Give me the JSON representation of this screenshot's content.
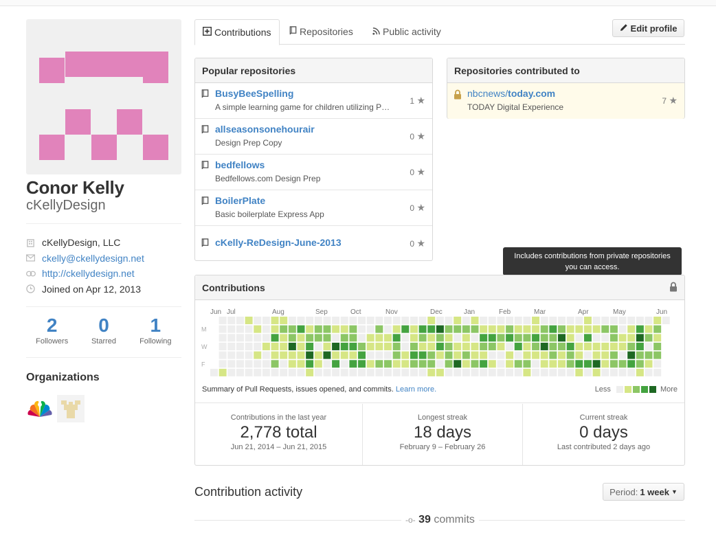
{
  "profile": {
    "full_name": "Conor Kelly",
    "username": "cKellyDesign",
    "avatar_color": "#e183bb",
    "details": [
      {
        "icon": "organization-icon",
        "text": "cKellyDesign, LLC",
        "link": false
      },
      {
        "icon": "mail-icon",
        "text": "ckelly@ckellydesign.net",
        "link": true
      },
      {
        "icon": "link-icon",
        "text": "http://ckellydesign.net",
        "link": true
      },
      {
        "icon": "clock-icon",
        "text": "Joined on Apr 12, 2013",
        "link": false
      }
    ],
    "stats": [
      {
        "value": "2",
        "label": "Followers"
      },
      {
        "value": "0",
        "label": "Starred"
      },
      {
        "value": "1",
        "label": "Following"
      }
    ],
    "organizations_title": "Organizations",
    "organizations": [
      "nbc-logo",
      "org-avatar"
    ]
  },
  "tabs": [
    {
      "label": "Contributions",
      "icon": "plus-square-icon",
      "selected": true
    },
    {
      "label": "Repositories",
      "icon": "repo-icon",
      "selected": false
    },
    {
      "label": "Public activity",
      "icon": "rss-icon",
      "selected": false
    }
  ],
  "edit_profile_label": "Edit profile",
  "popular": {
    "title": "Popular repositories",
    "repos": [
      {
        "name": "BusyBeeSpelling",
        "desc": "A simple learning game for children utilizing Pho",
        "stars": "1"
      },
      {
        "name": "allseasonsonehourair",
        "desc": "Design Prep Copy",
        "stars": "0"
      },
      {
        "name": "bedfellows",
        "desc": "Bedfellows.com Design Prep",
        "stars": "0"
      },
      {
        "name": "BoilerPlate",
        "desc": "Basic boilerplate Express App",
        "stars": "0"
      },
      {
        "name": "cKelly-ReDesign-June-2013",
        "desc": "",
        "stars": "0"
      }
    ]
  },
  "contributed": {
    "title": "Repositories contributed to",
    "repos": [
      {
        "owner": "nbcnews/",
        "name": "today.com",
        "desc": "TODAY Digital Experience",
        "stars": "7"
      }
    ]
  },
  "tooltip": "Includes contributions from private repositories you can access.",
  "contributions": {
    "title": "Contributions",
    "months": [
      "Jun",
      "Jul",
      "Aug",
      "Sep",
      "Oct",
      "Nov",
      "Dec",
      "Jan",
      "Feb",
      "Mar",
      "Apr",
      "May",
      "Jun"
    ],
    "days": [
      "M",
      "W",
      "F"
    ],
    "summary": "Summary of Pull Requests, issues opened, and commits.",
    "learn_more": "Learn more.",
    "legend_less": "Less",
    "legend_more": "More",
    "colors": [
      "#eeeeee",
      "#d6e685",
      "#8cc665",
      "#44a340",
      "#1e6823"
    ],
    "stats": [
      {
        "title": "Contributions in the last year",
        "value": "2,778 total",
        "sub": "Jun 21, 2014 – Jun 21, 2015"
      },
      {
        "title": "Longest streak",
        "value": "18 days",
        "sub": "February 9 – February 26"
      },
      {
        "title": "Current streak",
        "value": "0 days",
        "sub": "Last contributed 2 days ago"
      }
    ]
  },
  "activity": {
    "title": "Contribution activity",
    "period_label": "Period:",
    "period_value": "1 week",
    "commits_count": "39",
    "commits_label": "commits"
  }
}
